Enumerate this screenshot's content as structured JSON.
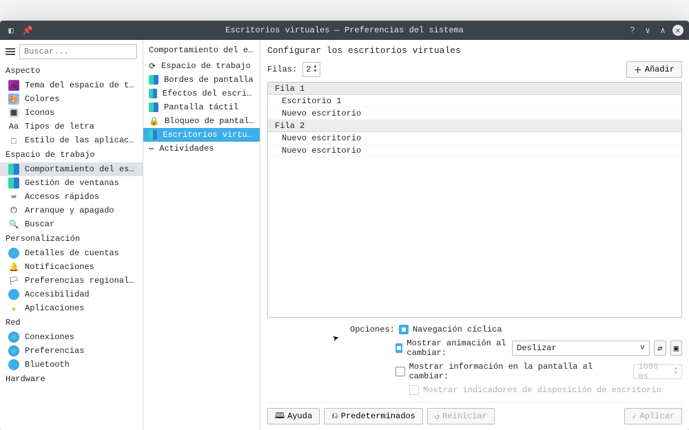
{
  "window": {
    "title": "Escritorios virtuales — Preferencias del sistema"
  },
  "search": {
    "placeholder": "Buscar..."
  },
  "sidebar1": {
    "sections": [
      {
        "label": "Aspecto",
        "items": [
          {
            "label": "Tema del espacio de tra…",
            "icon": "🖼",
            "icClass": "ic-pink"
          },
          {
            "label": "Colores",
            "icon": "🎨",
            "icClass": "ic-pal"
          },
          {
            "label": "Iconos",
            "icon": "🔳"
          },
          {
            "label": "Tipos de letra",
            "icon": "Aa"
          },
          {
            "label": "Estilo de las aplicacio…",
            "icon": "⬚"
          }
        ]
      },
      {
        "label": "Espacio de trabajo",
        "items": [
          {
            "label": "Comportamiento del escr…",
            "icon": "",
            "icClass": "ic-desk",
            "selected": true
          },
          {
            "label": "Gestión de ventanas",
            "icon": "",
            "icClass": "ic-desk"
          },
          {
            "label": "Accesos rápidos",
            "icon": "⌨"
          },
          {
            "label": "Arranque y apagado",
            "icon": "⏻"
          },
          {
            "label": "Buscar",
            "icon": "🔍"
          }
        ]
      },
      {
        "label": "Personalización",
        "items": [
          {
            "label": "Detalles de cuentas",
            "icon": "",
            "icClass": "ic-blue"
          },
          {
            "label": "Notificaciones",
            "icon": "🔔",
            "icClass": "ic-yel"
          },
          {
            "label": "Preferencias regionales",
            "icon": "🏳"
          },
          {
            "label": "Accesibilidad",
            "icon": "",
            "icClass": "ic-blue"
          },
          {
            "label": "Aplicaciones",
            "icon": "★",
            "icClass": "ic-star"
          }
        ]
      },
      {
        "label": "Red",
        "items": [
          {
            "label": "Conexiones",
            "icon": "",
            "icClass": "ic-globe"
          },
          {
            "label": "Preferencias",
            "icon": "",
            "icClass": "ic-globe"
          },
          {
            "label": "Bluetooth",
            "icon": "",
            "icClass": "ic-blue"
          }
        ]
      },
      {
        "label": "Hardware",
        "items": []
      }
    ]
  },
  "sidebar2": {
    "header": "Comportamiento del escritorio",
    "items": [
      {
        "label": "Espacio de trabajo",
        "icon": "⟳"
      },
      {
        "label": "Bordes de pantalla",
        "icon": "",
        "icClass": "ic-desk"
      },
      {
        "label": "Efectos del escritorio",
        "icon": "",
        "icClass": "ic-desk"
      },
      {
        "label": "Pantalla táctil",
        "icon": "",
        "icClass": "ic-desk"
      },
      {
        "label": "Bloqueo de pantalla",
        "icon": "🔒"
      },
      {
        "label": "Escritorios virtuales",
        "icon": "",
        "icClass": "ic-desk",
        "selected": true
      },
      {
        "label": "Actividades",
        "icon": "⋯"
      }
    ]
  },
  "main": {
    "title": "Configurar los escritorios virtuales",
    "rows_label": "Filas:",
    "rows_value": "2",
    "add_label": "Añadir",
    "table": [
      {
        "head": true,
        "label": "Fila 1"
      },
      {
        "head": false,
        "label": "Escritorio 1"
      },
      {
        "head": false,
        "label": "Nuevo escritorio"
      },
      {
        "head": true,
        "label": "Fila 2"
      },
      {
        "head": false,
        "label": "Nuevo escritorio"
      },
      {
        "head": false,
        "label": "Nuevo escritorio"
      }
    ],
    "options_label": "Opciones:",
    "opt_wrap": "Navegación cíclica",
    "opt_anim": "Mostrar animación al cambiar:",
    "anim_value": "Deslizar",
    "opt_osd": "Mostrar información en la pantalla al cambiar:",
    "osd_value": "1000 ms",
    "opt_indic": "Mostrar indicadores de disposición de escritorio"
  },
  "footer": {
    "help": "Ayuda",
    "defaults": "Predeterminados",
    "reset": "Reiniciar",
    "apply": "Aplicar"
  }
}
